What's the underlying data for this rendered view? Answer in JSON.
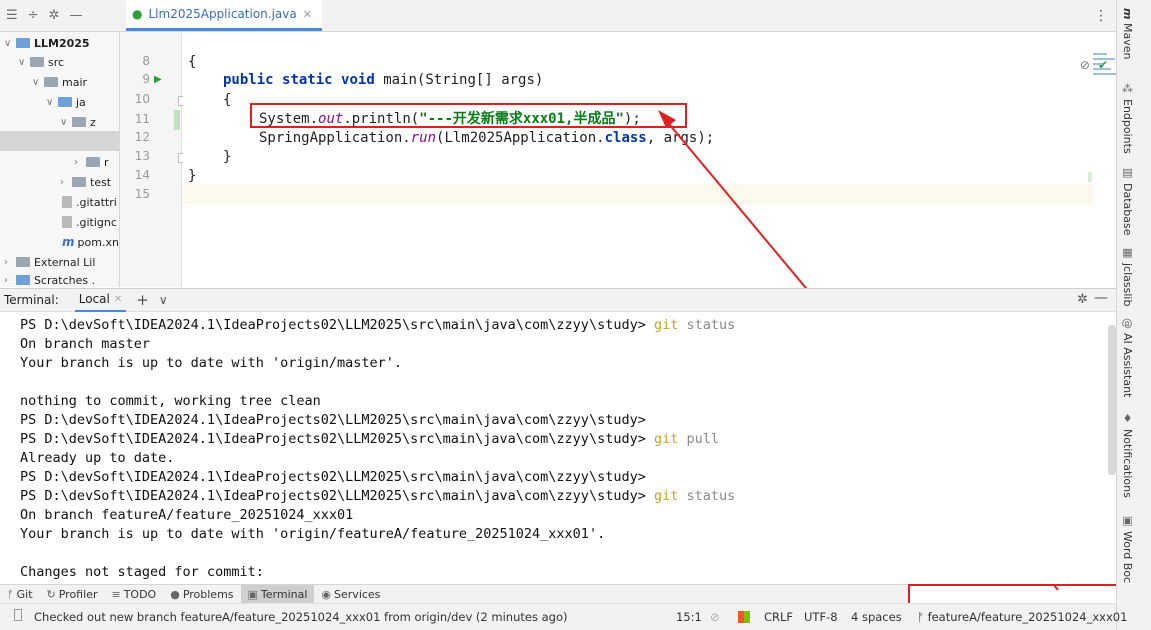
{
  "editor": {
    "tab_label": "Llm2025Application.java",
    "lines": [
      {
        "num": "8"
      },
      {
        "num": "9"
      },
      {
        "num": "10"
      },
      {
        "num": "11"
      },
      {
        "num": "12"
      },
      {
        "num": "13"
      },
      {
        "num": "14"
      },
      {
        "num": "15"
      }
    ],
    "code": {
      "l8": "{",
      "l9_kw1": "public",
      "l9_kw2": "static",
      "l9_kw3": "void",
      "l9_rest": "main(String[] args)",
      "l10": "{",
      "l11_pre": "System.",
      "l11_out": "out",
      "l11_mid": ".println(",
      "l11_str": "\"---开发新需求xxx01,半成品\"",
      "l11_end": ");",
      "l12_pre": "SpringApplication.",
      "l12_run": "run",
      "l12_mid": "(Llm2025Application.",
      "l12_kw": "class",
      "l12_end": ", args);",
      "l13": "}",
      "l14": "}"
    }
  },
  "project_tree": {
    "items": [
      {
        "label": "LLM2025"
      },
      {
        "label": "src"
      },
      {
        "label": "mair"
      },
      {
        "label": "ja"
      },
      {
        "label": "z"
      },
      {
        "label": "r"
      },
      {
        "label": "test"
      },
      {
        "label": ".gitattri"
      },
      {
        "label": ".gitignc"
      },
      {
        "label": "pom.xn"
      },
      {
        "label": "External Lil"
      },
      {
        "label": "Scratches ."
      }
    ]
  },
  "terminal": {
    "header_label": "Terminal:",
    "tab_label": "Local",
    "lines": [
      {
        "pre": "PS D:\\devSoft\\IDEA2024.1\\IdeaProjects02\\LLM2025\\src\\main\\java\\com\\zzyy\\study> ",
        "cmd": "git",
        "arg": " status"
      },
      {
        "pre": "On branch master",
        "cmd": "",
        "arg": ""
      },
      {
        "pre": "Your branch is up to date with 'origin/master'.",
        "cmd": "",
        "arg": ""
      },
      {
        "pre": "",
        "cmd": "",
        "arg": ""
      },
      {
        "pre": "nothing to commit, working tree clean",
        "cmd": "",
        "arg": ""
      },
      {
        "pre": "PS D:\\devSoft\\IDEA2024.1\\IdeaProjects02\\LLM2025\\src\\main\\java\\com\\zzyy\\study>",
        "cmd": "",
        "arg": ""
      },
      {
        "pre": "PS D:\\devSoft\\IDEA2024.1\\IdeaProjects02\\LLM2025\\src\\main\\java\\com\\zzyy\\study> ",
        "cmd": "git",
        "arg": " pull"
      },
      {
        "pre": "Already up to date.",
        "cmd": "",
        "arg": ""
      },
      {
        "pre": "PS D:\\devSoft\\IDEA2024.1\\IdeaProjects02\\LLM2025\\src\\main\\java\\com\\zzyy\\study>",
        "cmd": "",
        "arg": ""
      },
      {
        "pre": "PS D:\\devSoft\\IDEA2024.1\\IdeaProjects02\\LLM2025\\src\\main\\java\\com\\zzyy\\study> ",
        "cmd": "git",
        "arg": " status"
      },
      {
        "pre": "On branch featureA/feature_20251024_xxx01",
        "cmd": "",
        "arg": ""
      },
      {
        "pre": "Your branch is up to date with 'origin/featureA/feature_20251024_xxx01'.",
        "cmd": "",
        "arg": ""
      },
      {
        "pre": "",
        "cmd": "",
        "arg": ""
      },
      {
        "pre": "Changes not staged for commit:",
        "cmd": "",
        "arg": ""
      }
    ]
  },
  "bottom_tabs": [
    {
      "label": "Git"
    },
    {
      "label": "Profiler"
    },
    {
      "label": "TODO"
    },
    {
      "label": "Problems"
    },
    {
      "label": "Terminal"
    },
    {
      "label": "Services"
    }
  ],
  "status_bar": {
    "message": "Checked out new branch featureA/feature_20251024_xxx01 from origin/dev (2 minutes ago)",
    "position": "15:1",
    "line_sep": "CRLF",
    "encoding": "UTF-8",
    "indent": "4 spaces",
    "branch": "featureA/feature_20251024_xxx01"
  },
  "right_tools": [
    {
      "label": "Maven"
    },
    {
      "label": "Endpoints"
    },
    {
      "label": "Database"
    },
    {
      "label": "jclasslib"
    },
    {
      "label": "AI Assistant"
    },
    {
      "label": "Notifications"
    },
    {
      "label": "Word Boc"
    }
  ],
  "colors": {
    "highlight": "#e02020",
    "accent": "#4a88d8",
    "git_cmd": "#c9a227"
  }
}
